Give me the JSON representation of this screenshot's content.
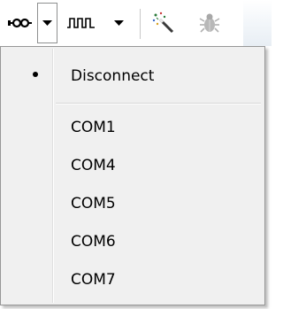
{
  "toolbar": {
    "connect_icon": "connect-plug-icon",
    "connect_dropdown_icon": "triangle-down-icon",
    "signal_icon": "square-wave-icon",
    "signal_dropdown_icon": "triangle-down-icon",
    "wand_icon": "magic-wand-icon",
    "bug_icon": "bug-icon"
  },
  "menu": {
    "selected_item": "Disconnect",
    "items": [
      {
        "label": "Disconnect",
        "checked": true
      },
      {
        "label": "COM1",
        "checked": false
      },
      {
        "label": "COM4",
        "checked": false
      },
      {
        "label": "COM5",
        "checked": false
      },
      {
        "label": "COM6",
        "checked": false
      },
      {
        "label": "COM7",
        "checked": false
      }
    ]
  },
  "colors": {
    "menu_background": "#f0f0f0",
    "menu_border": "#979797",
    "toolbar_background": "#ffffff",
    "wand_sparkle": "#2a7a3a",
    "bug_disabled": "#b0b0b0"
  }
}
